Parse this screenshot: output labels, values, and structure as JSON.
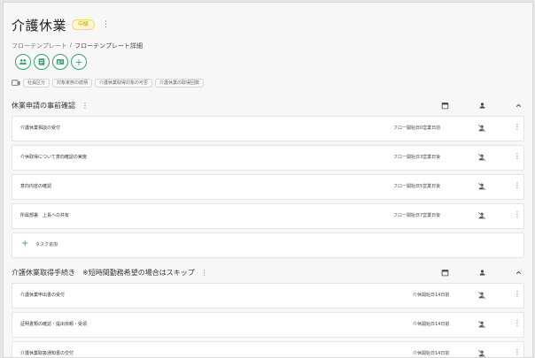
{
  "header": {
    "title": "介護休業",
    "badge": "中級",
    "kebab": "⋮",
    "breadcrumb": {
      "parent": "フローテンプレート",
      "separator": "/",
      "current": "フローテンプレート詳細"
    }
  },
  "quick_actions": {
    "icons": [
      "people-icon",
      "clipboard-icon",
      "id-card-icon"
    ],
    "add_label": "+"
  },
  "tags": {
    "icon": "slides-icon",
    "items": [
      "社員区分",
      "対象家族の続柄",
      "介護休業取得対象の可否",
      "介護休業の取得回数"
    ]
  },
  "sections": [
    {
      "title": "休業申請の事前確認",
      "kebab": "⋮",
      "tasks": [
        {
          "name": "介護休業相談の受付",
          "due": "フロー開始日0営業日前"
        },
        {
          "name": "介休取得について意向確認の実施",
          "due": "フロー開始日3営業日後"
        },
        {
          "name": "意向内容の確認",
          "due": "フロー開始日5営業日後"
        },
        {
          "name": "所属部署　上長への共有",
          "due": "フロー開始日7営業日後"
        }
      ],
      "add_task": {
        "plus": "+",
        "label": "タスク追加"
      }
    },
    {
      "title": "介護休業取得手続き　※短時間勤務希望の場合はスキップ",
      "kebab": "⋮",
      "tasks": [
        {
          "name": "介護休業申出書の受付",
          "due": "介休開始日14日前"
        },
        {
          "name": "証明書類の確認・提出依頼・受領",
          "due": "介休開始日14日前"
        },
        {
          "name": "介護休業取扱通知書の交付",
          "due": "介休開始日14日前"
        }
      ]
    }
  ],
  "row_kebab": "⋮",
  "colors": {
    "accent": "#38a169",
    "badge": "#f1d86d"
  }
}
